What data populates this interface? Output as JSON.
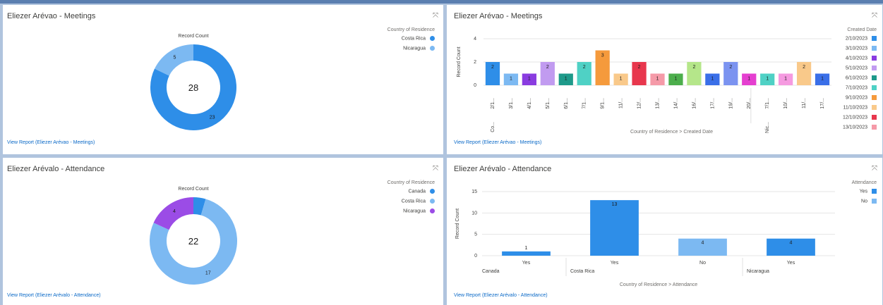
{
  "panels": {
    "p1": {
      "title": "Eliezer Arévao - Meetings",
      "chart_title": "Record Count",
      "center_total": "28",
      "legend_title": "Country of Residence",
      "view_report": "View Report (Eliezer Arévao - Meetings)"
    },
    "p2": {
      "title": "Eliezer Arévao - Meetings",
      "ylabel": "Record Count",
      "legend_title": "Created Date",
      "xaxis_title": "Country of Residence  >  Created Date",
      "group_labels": [
        "Co...",
        "Nic..."
      ],
      "view_report": "View Report (Eliezer Arévao - Meetings)"
    },
    "p3": {
      "title": "Eliezer Arévalo - Attendance",
      "chart_title": "Record Count",
      "center_total": "22",
      "legend_title": "Country of Residence",
      "view_report": "View Report (Eliezer Arévalo - Attendance)"
    },
    "p4": {
      "title": "Eliezer Arévalo - Attendance",
      "ylabel": "Record Count",
      "legend_title": "Attendance",
      "xaxis_title": "Country of Residence  >  Attendance",
      "group_labels": [
        "Canada",
        "Costa Rica",
        "Nicaragua"
      ],
      "view_report": "View Report (Eliezer Arévalo - Attendance)"
    }
  },
  "chart_data": [
    {
      "type": "donut",
      "title": "Record Count",
      "total": 28,
      "slices": [
        {
          "name": "Costa Rica",
          "value": 23,
          "color": "#2e8ee8"
        },
        {
          "name": "Nicaragua",
          "value": 5,
          "color": "#7cb9f2"
        }
      ],
      "legend_title": "Country of Residence",
      "legend": "top-right"
    },
    {
      "type": "bar",
      "ylabel": "Record Count",
      "xlabel": "Country of Residence  >  Created Date",
      "ylim": [
        0,
        4
      ],
      "yticks": [
        0,
        2,
        4
      ],
      "categories": [
        "2/1...",
        "3/1...",
        "4/1...",
        "5/1...",
        "6/1...",
        "7/1...",
        "9/1...",
        "11/...",
        "12/...",
        "13/...",
        "14/...",
        "16/...",
        "17/...",
        "19/...",
        "20/...",
        "7/1...",
        "10/...",
        "11/...",
        "17/..."
      ],
      "groups": [
        {
          "label": "Co...",
          "count": 15
        },
        {
          "label": "Nic...",
          "count": 4
        }
      ],
      "values": [
        2,
        1,
        1,
        2,
        1,
        2,
        3,
        1,
        2,
        1,
        1,
        2,
        1,
        2,
        1,
        1,
        1,
        2,
        1
      ],
      "colors": [
        "#2e8ee8",
        "#7cb9f2",
        "#8a3ce0",
        "#c19bf0",
        "#1e9a8a",
        "#4fd1c5",
        "#f59a3c",
        "#f9c98a",
        "#e8374d",
        "#f59aa8",
        "#4cae4c",
        "#b5e68a",
        "#3a6fe8",
        "#7b93f0",
        "#e53fd0",
        "#4fd1c5",
        "#f59ae0",
        "#f9c98a",
        "#3a6fe8"
      ],
      "legend_title": "Created Date",
      "legend_items": [
        {
          "label": "2/10/2023",
          "color": "#2e8ee8"
        },
        {
          "label": "3/10/2023",
          "color": "#7cb9f2"
        },
        {
          "label": "4/10/2023",
          "color": "#8a3ce0"
        },
        {
          "label": "5/10/2023",
          "color": "#c19bf0"
        },
        {
          "label": "6/10/2023",
          "color": "#1e9a8a"
        },
        {
          "label": "7/10/2023",
          "color": "#4fd1c5"
        },
        {
          "label": "9/10/2023",
          "color": "#f59a3c"
        },
        {
          "label": "11/10/2023",
          "color": "#f9c98a"
        },
        {
          "label": "12/10/2023",
          "color": "#e8374d"
        },
        {
          "label": "13/10/2023",
          "color": "#f59aa8"
        }
      ],
      "legend": "right"
    },
    {
      "type": "donut",
      "title": "Record Count",
      "total": 22,
      "slices": [
        {
          "name": "Canada",
          "value": 1,
          "color": "#2e8ee8"
        },
        {
          "name": "Costa Rica",
          "value": 17,
          "color": "#7cb9f2"
        },
        {
          "name": "Nicaragua",
          "value": 4,
          "color": "#9b4ce6"
        }
      ],
      "legend_title": "Country of Residence",
      "legend": "top-right"
    },
    {
      "type": "bar",
      "ylabel": "Record Count",
      "xlabel": "Country of Residence  >  Attendance",
      "ylim": [
        0,
        15
      ],
      "yticks": [
        0,
        5,
        10,
        15
      ],
      "bars": [
        {
          "group": "Canada",
          "category": "Yes",
          "value": 1,
          "series": "Yes"
        },
        {
          "group": "Costa Rica",
          "category": "Yes",
          "value": 13,
          "series": "Yes"
        },
        {
          "group": "Costa Rica",
          "category": "No",
          "value": 4,
          "series": "No"
        },
        {
          "group": "Nicaragua",
          "category": "Yes",
          "value": 4,
          "series": "Yes"
        }
      ],
      "series": [
        {
          "name": "Yes",
          "color": "#2e8ee8"
        },
        {
          "name": "No",
          "color": "#7cb9f2"
        }
      ],
      "legend_title": "Attendance",
      "legend": "top-right"
    }
  ]
}
